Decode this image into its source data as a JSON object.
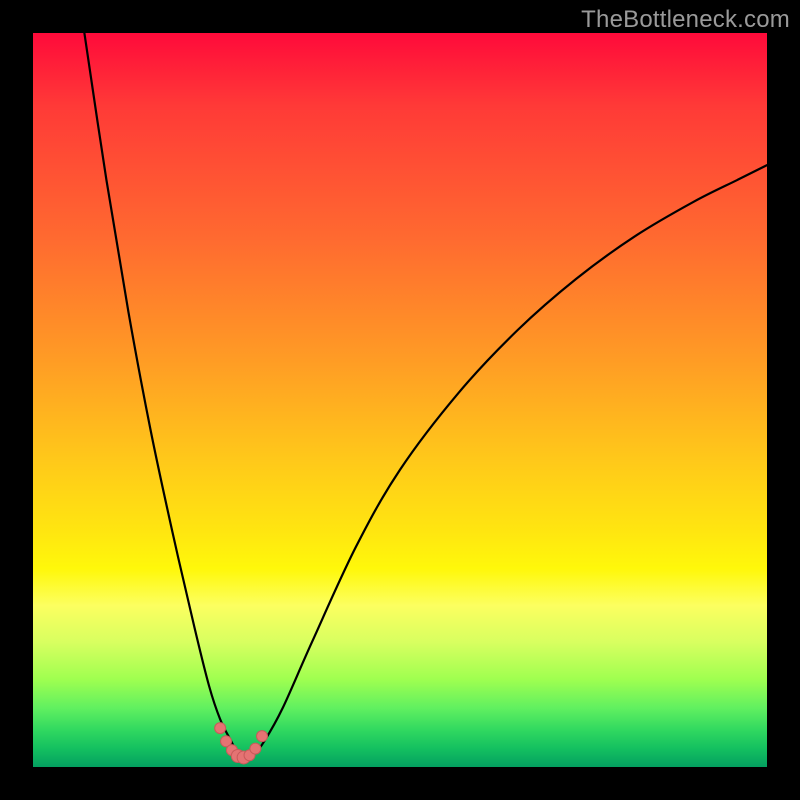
{
  "watermark": "TheBottleneck.com",
  "dimensions": {
    "outer": 800,
    "inner": 734,
    "margin": 33
  },
  "colors": {
    "frame": "#000000",
    "curve": "#000000",
    "marker_fill": "#e57373",
    "marker_stroke": "#c85a5a",
    "gradient_stops": [
      "#ff0a3a",
      "#ff3a37",
      "#ff6a30",
      "#ff9a25",
      "#ffc81a",
      "#ffe610",
      "#fff80a",
      "#fcff60",
      "#d8ff60",
      "#a0ff50",
      "#60f060",
      "#30d860",
      "#14c060",
      "#04a060"
    ]
  },
  "chart_data": {
    "type": "line",
    "title": "",
    "xlabel": "",
    "ylabel": "",
    "xlim": [
      0,
      100
    ],
    "ylim": [
      0,
      100
    ],
    "grid": false,
    "legend": false,
    "minimum_x": 28.5,
    "series": [
      {
        "name": "left_branch",
        "x": [
          7.0,
          10.0,
          13.0,
          16.0,
          19.0,
          22.0,
          24.0,
          25.5,
          27.0,
          28.0,
          28.5
        ],
        "y": [
          100.0,
          80.0,
          62.0,
          46.0,
          32.0,
          19.0,
          11.0,
          6.5,
          3.5,
          1.6,
          0.8
        ]
      },
      {
        "name": "right_branch",
        "x": [
          28.5,
          30.0,
          31.5,
          34.0,
          38.0,
          44.0,
          50.0,
          58.0,
          66.0,
          74.0,
          82.0,
          90.0,
          96.0,
          100.0
        ],
        "y": [
          0.8,
          1.6,
          3.5,
          8.0,
          17.0,
          30.0,
          40.5,
          51.0,
          59.5,
          66.5,
          72.3,
          77.0,
          80.0,
          82.0
        ]
      }
    ],
    "markers": {
      "name": "highlight",
      "x": [
        25.5,
        26.3,
        27.1,
        27.9,
        28.7,
        29.5,
        30.3,
        31.2
      ],
      "y": [
        5.3,
        3.5,
        2.3,
        1.5,
        1.3,
        1.6,
        2.5,
        4.2
      ],
      "r": [
        5.5,
        5.5,
        5.5,
        6.5,
        6.5,
        5.5,
        5.5,
        5.5
      ]
    }
  }
}
